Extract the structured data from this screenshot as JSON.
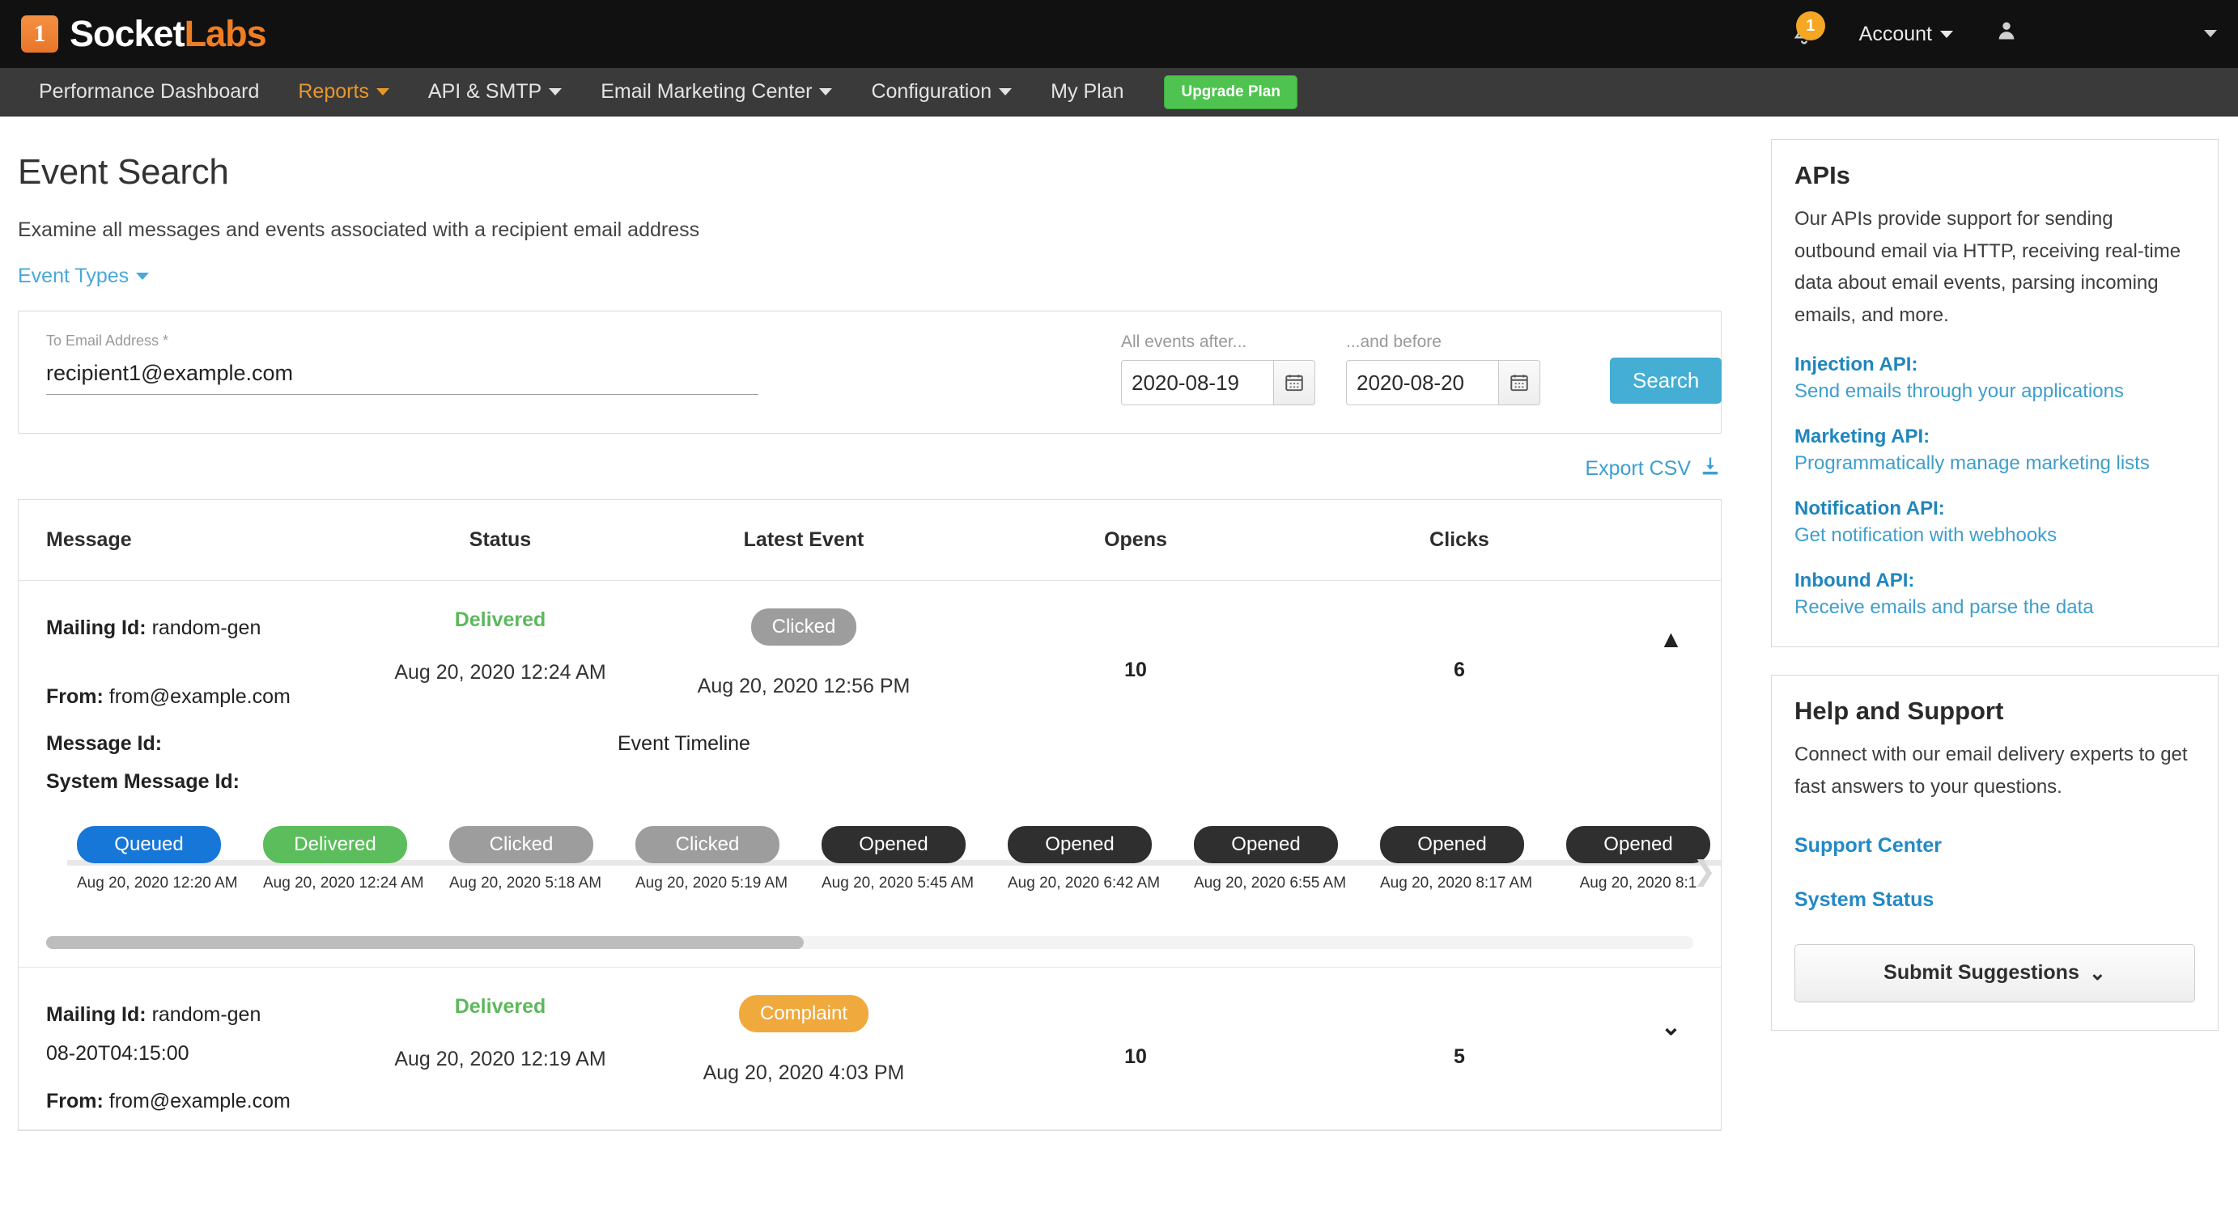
{
  "header": {
    "logo_word1": "Socket",
    "logo_word2": "Labs",
    "logo_glyph": "1",
    "notification_count": "1",
    "account_label": "Account"
  },
  "nav": {
    "items": [
      {
        "label": "Performance Dashboard",
        "has_caret": false,
        "active": false
      },
      {
        "label": "Reports",
        "has_caret": true,
        "active": true
      },
      {
        "label": "API & SMTP",
        "has_caret": true,
        "active": false
      },
      {
        "label": "Email Marketing Center",
        "has_caret": true,
        "active": false
      },
      {
        "label": "Configuration",
        "has_caret": true,
        "active": false
      },
      {
        "label": "My Plan",
        "has_caret": false,
        "active": false
      }
    ],
    "upgrade_label": "Upgrade Plan",
    "upgrade_color": "#4fc34f"
  },
  "page": {
    "title": "Event Search",
    "subtitle": "Examine all messages and events associated with a recipient email address",
    "event_types_label": "Event Types"
  },
  "search": {
    "email_label": "To Email Address *",
    "email_value": "recipient1@example.com",
    "email_placeholder": "",
    "after_label": "All events after...",
    "after_value": "2020-08-19",
    "before_label": "...and before",
    "before_value": "2020-08-20",
    "search_button": "Search",
    "search_button_color": "#44aed4"
  },
  "export": {
    "label": "Export CSV"
  },
  "table": {
    "columns": [
      "Message",
      "Status",
      "Latest Event",
      "Opens",
      "Clicks"
    ],
    "rows": [
      {
        "mailing_id_label": "Mailing Id:",
        "mailing_id_value": "random-gen",
        "mailing_id_value2": "",
        "from_label": "From:",
        "from_value": "from@example.com",
        "message_id_label": "Message Id:",
        "system_message_id_label": "System Message Id:",
        "status": "Delivered",
        "status_color": "#5cb85c",
        "status_date": "Aug 20, 2020 12:24 AM",
        "latest_event": "Clicked",
        "latest_event_style": "clicked",
        "latest_event_date": "Aug 20, 2020 12:56 PM",
        "opens": "10",
        "clicks": "6",
        "toggle": "▲",
        "expanded": true,
        "timeline_title": "Event Timeline",
        "timeline": [
          {
            "label": "Queued",
            "style": "queued",
            "date": "Aug 20, 2020 12:20 AM"
          },
          {
            "label": "Delivered",
            "style": "delivered",
            "date": "Aug 20, 2020 12:24 AM"
          },
          {
            "label": "Clicked",
            "style": "clicked",
            "date": "Aug 20, 2020 5:18 AM"
          },
          {
            "label": "Clicked",
            "style": "clicked",
            "date": "Aug 20, 2020 5:19 AM"
          },
          {
            "label": "Opened",
            "style": "opened",
            "date": "Aug 20, 2020 5:45 AM"
          },
          {
            "label": "Opened",
            "style": "opened",
            "date": "Aug 20, 2020 6:42 AM"
          },
          {
            "label": "Opened",
            "style": "opened",
            "date": "Aug 20, 2020 6:55 AM"
          },
          {
            "label": "Opened",
            "style": "opened",
            "date": "Aug 20, 2020 8:17 AM"
          },
          {
            "label": "Opened",
            "style": "opened",
            "date": "Aug 20, 2020 8:1"
          }
        ]
      },
      {
        "mailing_id_label": "Mailing Id:",
        "mailing_id_value": "random-gen",
        "mailing_id_value2": "08-20T04:15:00",
        "from_label": "From:",
        "from_value": "from@example.com",
        "status": "Delivered",
        "status_color": "#5cb85c",
        "status_date": "Aug 20, 2020 12:19 AM",
        "latest_event": "Complaint",
        "latest_event_style": "complaint",
        "latest_event_date": "Aug 20, 2020 4:03 PM",
        "opens": "10",
        "clicks": "5",
        "toggle": "⌄",
        "expanded": false
      }
    ]
  },
  "sidebar": {
    "apis": {
      "title": "APIs",
      "description": "Our APIs provide support for sending outbound email via HTTP, receiving real-time data about email events, parsing incoming emails, and more.",
      "links": [
        {
          "name": "Injection API:",
          "desc": "Send emails through your applications"
        },
        {
          "name": "Marketing API:",
          "desc": "Programmatically manage marketing lists"
        },
        {
          "name": "Notification API:",
          "desc": "Get notification with webhooks"
        },
        {
          "name": "Inbound API:",
          "desc": "Receive emails and parse the data"
        }
      ]
    },
    "help": {
      "title": "Help and Support",
      "description": "Connect with our email delivery experts to get fast answers to your questions.",
      "links": [
        "Support Center",
        "System Status"
      ],
      "button_label": "Submit Suggestions"
    }
  }
}
